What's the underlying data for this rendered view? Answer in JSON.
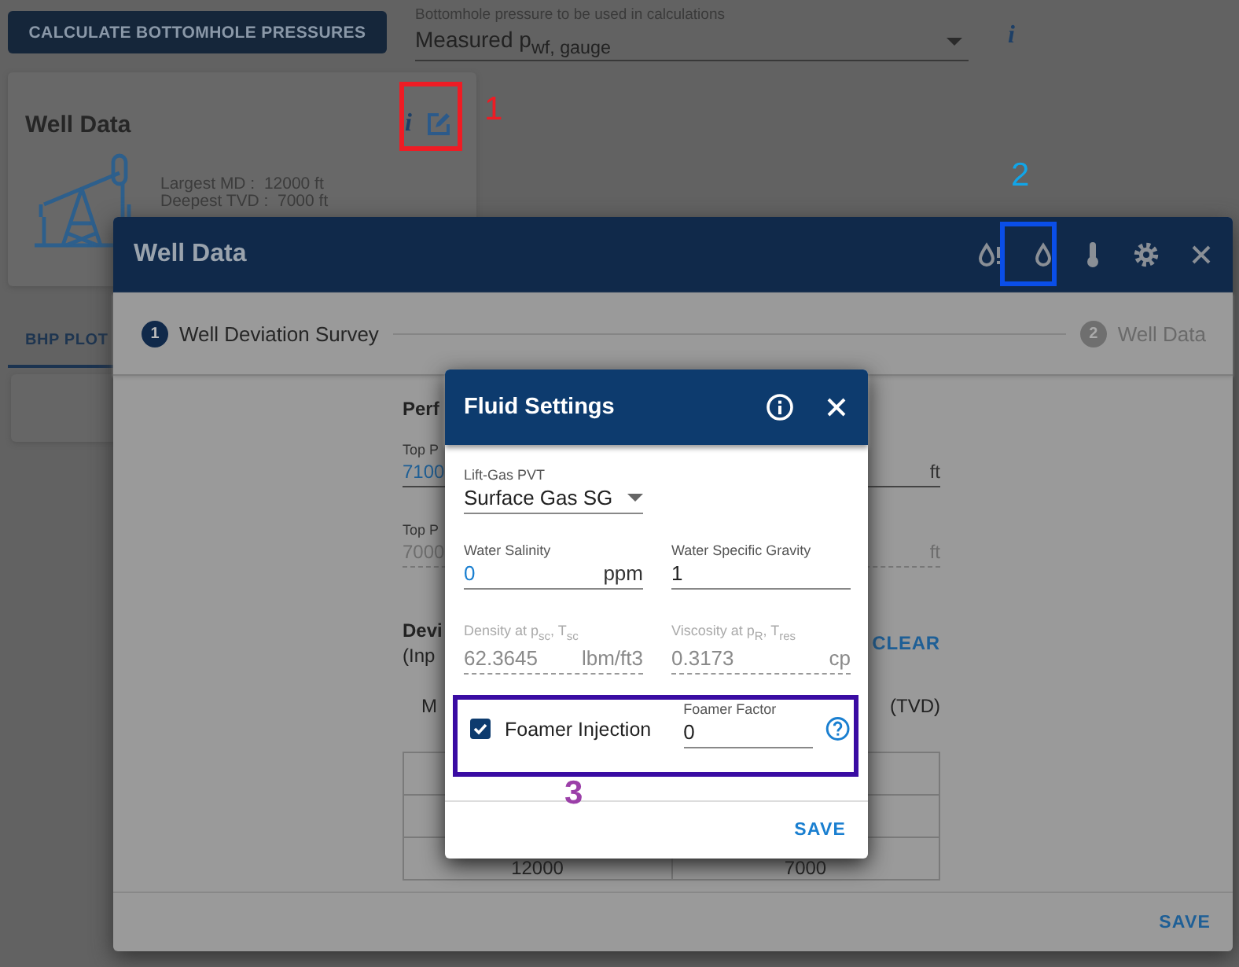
{
  "page": {
    "calculate_button": "CALCULATE BOTTOMHOLE PRESSURES",
    "bhp_select": {
      "label": "Bottomhole pressure to be used in calculations",
      "value": "Measured p$_{wf, gauge}$"
    },
    "info_glyph": "i",
    "well_card": {
      "title": "Well Data",
      "info_glyph": "i",
      "stats": [
        "Largest MD :  12000 ft",
        "Deepest TVD :  7000 ft"
      ]
    },
    "tabs": [
      {
        "label": "BHP PLOT",
        "selected": true
      }
    ]
  },
  "well_dialog": {
    "title": "Well Data",
    "steps": [
      {
        "number": "1",
        "label": "Well Deviation Survey",
        "selected": true
      },
      {
        "number": "2",
        "label": "Well Data",
        "selected": false
      }
    ],
    "heading": "Perf",
    "fields": [
      {
        "label": "Top P",
        "value": "7100",
        "unit": "ft",
        "disabled": false
      },
      {
        "label": "Top P",
        "value": "7000",
        "unit": "ft",
        "disabled": true
      }
    ],
    "section_title": "Devi",
    "section_note": "(Inp",
    "clear_button": "CLEAR",
    "column_headers": [
      "M",
      "(TVD)"
    ],
    "last_row": [
      "12000",
      "7000"
    ],
    "save_button": "SAVE"
  },
  "fluid_dialog": {
    "title": "Fluid Settings",
    "lift_gas": {
      "label": "Lift-Gas PVT",
      "value": "Surface Gas SG"
    },
    "fields": [
      {
        "label": "Water Salinity",
        "value": "0",
        "unit": "ppm",
        "disabled": false,
        "accent": true
      },
      {
        "label": "Water Specific Gravity",
        "value": "1",
        "disabled": false,
        "accent": false
      },
      {
        "label": "Density at p$_{sc}$, T$_{sc}$",
        "value": "62.3645",
        "unit": "lbm/ft3",
        "disabled": true,
        "accent": false
      },
      {
        "label": "Viscosity at p$_{R}$, T$_{res}$",
        "value": "0.3173",
        "unit": "cp",
        "disabled": true,
        "accent": false
      }
    ],
    "foamer": {
      "label": "Foamer Injection",
      "checked": true,
      "factor_label": "Foamer Factor",
      "factor_value": "0"
    },
    "save_button": "SAVE"
  },
  "highlight_frames": [
    {
      "color": "#ee1c24"
    },
    {
      "color": "#0a4ee8"
    },
    {
      "color": "#3a0ca3"
    }
  ],
  "callout_numbers": [
    {
      "label": "1",
      "color": "#ee1c24"
    },
    {
      "label": "2",
      "color": "#11a5e8"
    },
    {
      "label": "3",
      "color": "#9b3fa8"
    }
  ]
}
